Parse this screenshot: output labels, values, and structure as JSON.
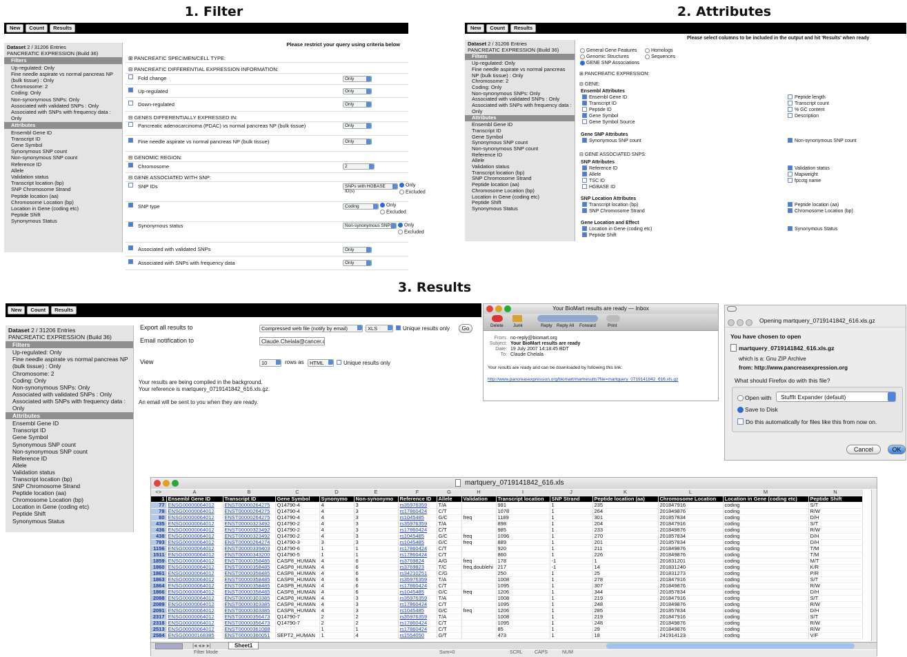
{
  "titles": {
    "filter": "1. Filter",
    "attributes": "2. Attributes",
    "results": "3. Results"
  },
  "toolbar": {
    "new": "New",
    "count": "Count",
    "results": "Results"
  },
  "dataset": {
    "label": "Dataset",
    "value": "2 / 31206 Entries",
    "name": "PANCREATIC EXPRESSION (Build 36)"
  },
  "sidebar": {
    "filters_hd": "Filters",
    "filters": [
      "Up-regulated: Only",
      "Fine needle aspirate vs normal pancreas NP (bulk tissue) : Only",
      "Chromosome: 2",
      "Coding: Only",
      "Non-synonymous SNPs: Only",
      "Associated with validated SNPs : Only",
      "Associated with SNPs with frequency data : Only"
    ],
    "attrs_hd": "Attributes",
    "attrs": [
      "Ensembl Gene ID",
      "Transcript ID",
      "Gene Symbol",
      "Synonymous SNP count",
      "Non-synonymous SNP count",
      "Reference ID",
      "Allele",
      "Validation status",
      "Transcript location (bp)",
      "SNP Chromosome Strand",
      "Peptide location (aa)",
      "Chromosome Location (bp)",
      "Location in Gene (coding etc)",
      "Peptide Shift",
      "Synonymous Status"
    ]
  },
  "filter": {
    "header": "Please restrict your query using criteria below",
    "sec_specimen": "⊞ PANCREATIC SPECIMEN/CELL TYPE:",
    "sec_diff": "⊟ PANCREATIC DIFFERENTIAL EXPRESSION INFORMATION:",
    "fold": "Fold change",
    "up": "Up-regulated",
    "down": "Down-regulated",
    "sec_genes": "⊟ GENES DIFFERENTIALLY EXPRESSED IN:",
    "pdac": "Pancreatic adenocarcinoma (PDAC) vs normal pancreas NP (bulk tissue)",
    "fna": "Fine needle aspirate vs normal pancreas NP (bulk tissue)",
    "sec_region": "⊟ GENOMIC REGION:",
    "chromosome": "Chromosome",
    "chrom_val": "2",
    "sec_snp": "⊟ GENE ASSOCIATED WITH SNP:",
    "snpids": "SNP IDs",
    "snptype": "SNP type",
    "synstatus": "Synonymous status",
    "validated": "Associated with validated SNPs",
    "freq": "Associated with SNPs with frequency data",
    "only": "Only",
    "excluded": "Excluded",
    "sel_only": "Only",
    "sel_hgbase": "SNPs with HGBASE ID(s)",
    "sel_coding": "Coding",
    "sel_nonsyn": "Non-synonymous SNPs"
  },
  "attributes": {
    "header": "Please select columns to be included in the output and hit 'Results' when ready",
    "opt1": "General Gene Features",
    "opt2": "Homologs",
    "opt3": "Genomic Structures",
    "opt4": "Sequences",
    "opt5": "GENE SNP Associations",
    "sec_pe": "⊞ PANCREATIC EXPRESSION:",
    "sec_gene": "⊟ GENE:",
    "ens_hd": "Ensembl Attributes",
    "ens_left": [
      "Ensembl Gene ID",
      "Transcript ID",
      "Peptide ID",
      "Gene Symbol",
      "Gene Symbol Source"
    ],
    "ens_right": [
      "Peptide length",
      "Transcript count",
      "% GC content",
      "Description"
    ],
    "gsnp_hd": "Gene SNP Attributes",
    "gsnp_l": "Synonymous SNP count",
    "gsnp_r": "Non-synonymous SNP count",
    "sec_assoc": "⊟ GENE ASSOCIATED SNPS:",
    "snp_hd": "SNP Attributes",
    "snp_left": [
      "Reference ID",
      "Allele",
      "TSC ID",
      "HGBASE ID"
    ],
    "snp_right": [
      "Validation status",
      "Mapweight",
      "fpcctg name"
    ],
    "loc_hd": "SNP Location Attributes",
    "loc_l": [
      "Transcript location (bp)",
      "SNP Chromosome Strand"
    ],
    "loc_r": [
      "Peptide location (aa)",
      "Chromosome Location (bp)"
    ],
    "gle_hd": "Gene Location and Effect",
    "gle_l": [
      "Location in Gene (coding etc)",
      "Peptide Shift"
    ],
    "gle_r": [
      "Synonymous Status"
    ]
  },
  "results": {
    "export_label": "Export  all results to",
    "export_sel": "Compressed web file (notify by email)",
    "fmt": "XLS",
    "unique": "Unique results only",
    "go": "Go",
    "email_label": "Email notification to",
    "email": "Claude.Chelala@cancer.c",
    "view_label": "View",
    "view_n": "10",
    "rows_as": "rows as",
    "view_fmt": "HTML",
    "view_unique": "Unique results only",
    "msg1": "Your results are being compiled in the background.",
    "msg2": "Your reference is martquery_0719141842_616.xls.gz.",
    "msg3": "An email will be sent to you when they are ready."
  },
  "mail": {
    "title": "Your BioMart results are ready — Inbox",
    "tools": [
      "Delete",
      "Junk",
      "Reply",
      "Reply All",
      "Forward",
      "Print"
    ],
    "from_l": "From:",
    "from": "no-reply@biomart.org",
    "subj_l": "Subject:",
    "subj": "Your BioMart results are ready",
    "date_l": "Date:",
    "date": "19 July 2007 14:18:45 BDT",
    "to_l": "To:",
    "to": "Claude Chelala",
    "body": "Your results are ready and can be downloaded by following this link:",
    "link": "http://www.pancreasexpression.org/biomart/martresults?file=martquery_0719141842_616.xls.gz"
  },
  "dialog": {
    "title": "Opening martquery_0719141842_616.xls.gz",
    "chosen": "You have chosen to open",
    "file": "martquery_0719141842_616.xls.gz",
    "which": "which is a:  Gnu ZIP Archive",
    "from": "from:  http://www.pancreasexpression.org",
    "q": "What should Firefox do with this file?",
    "openwith": "Open with",
    "app": "StuffIt Expander (default)",
    "save": "Save to Disk",
    "auto": "Do this automatically for files like this from now on.",
    "cancel": "Cancel",
    "ok": "OK"
  },
  "excel": {
    "title": "martquery_0719141842_616.xls",
    "cols": [
      "A",
      "B",
      "C",
      "D",
      "E",
      "F",
      "G",
      "H",
      "I",
      "J",
      "K",
      "L",
      "M",
      "N"
    ],
    "headers": [
      "Ensembl Gene ID",
      "Transcript ID",
      "Gene Symbol",
      "Synonymo",
      "Non-synonymo",
      "Reference ID",
      "Allele",
      "Validation",
      "Transcript location",
      "SNP Strand",
      "Peptide location (aa)",
      "Chromosome Location",
      "Location in Gene (coding etc)",
      "Peptide Shift"
    ],
    "rows": [
      [
        "77",
        "ENSG00000064012",
        "ENST00000264275",
        "Q14790-4",
        "4",
        "3",
        "rs35976359",
        "T/A",
        "",
        "991",
        "1",
        "235",
        "201847916",
        "coding",
        "S/T"
      ],
      [
        "78",
        "ENSG00000064012",
        "ENST00000264275",
        "Q14790-4",
        "4",
        "3",
        "rs17860424",
        "C/T",
        "",
        "1078",
        "1",
        "264",
        "201849876",
        "coding",
        "R/W"
      ],
      [
        "80",
        "ENSG00000064012",
        "ENST00000264275",
        "Q14790-4",
        "4",
        "3",
        "rs1045485",
        "G/C",
        "freq",
        "1189",
        "1",
        "301",
        "201857834",
        "coding",
        "D/H"
      ],
      [
        "435",
        "ENSG00000064012",
        "ENST00000323492",
        "Q14790-2",
        "4",
        "3",
        "rs35976359",
        "T/A",
        "",
        "898",
        "1",
        "204",
        "201847916",
        "coding",
        "S/T"
      ],
      [
        "436",
        "ENSG00000064012",
        "ENST00000323492",
        "Q14790-2",
        "4",
        "3",
        "rs17860424",
        "C/T",
        "",
        "985",
        "1",
        "233",
        "201849876",
        "coding",
        "R/W"
      ],
      [
        "438",
        "ENSG00000064012",
        "ENST00000323492",
        "Q14790-2",
        "4",
        "3",
        "rs1045485",
        "G/C",
        "freq",
        "1096",
        "1",
        "270",
        "201857834",
        "coding",
        "D/H"
      ],
      [
        "793",
        "ENSG00000064012",
        "ENST00000264274",
        "Q14790-3",
        "3",
        "3",
        "rs1045485",
        "G/C",
        "freq",
        "889",
        "1",
        "201",
        "201857834",
        "coding",
        "D/H"
      ],
      [
        "1156",
        "ENSG00000064012",
        "ENST00000339403",
        "Q14790-6",
        "1",
        "1",
        "rs17860424",
        "C/T",
        "",
        "920",
        "1",
        "211",
        "201849876",
        "coding",
        "T/M"
      ],
      [
        "1511",
        "ENSG00000064012",
        "ENST00000343200",
        "Q14790-5",
        "1",
        "1",
        "rs17860424",
        "C/T",
        "",
        "860",
        "1",
        "226",
        "201849876",
        "coding",
        "T/M"
      ],
      [
        "1859",
        "ENSG00000064012",
        "ENST00000358485",
        "CASP8_HUMAN",
        "4",
        "6",
        "rs3769824",
        "A/G",
        "freq",
        "178",
        "-1",
        "1",
        "201831201",
        "coding",
        "M/T"
      ],
      [
        "1860",
        "ENSG00000064012",
        "ENST00000358485",
        "CASP8_HUMAN",
        "4",
        "6",
        "rs3769823",
        "T/C",
        "freq,doublehi",
        "217",
        "-1",
        "14",
        "201831240",
        "coding",
        "K/R"
      ],
      [
        "1861",
        "ENSG00000064012",
        "ENST00000358485",
        "CASP8_HUMAN",
        "4",
        "6",
        "rs34210251",
        "C/G",
        "",
        "250",
        "1",
        "25",
        "201831273",
        "coding",
        "P/R"
      ],
      [
        "1863",
        "ENSG00000064012",
        "ENST00000358485",
        "CASP8_HUMAN",
        "4",
        "6",
        "rs35976359",
        "T/A",
        "",
        "1008",
        "1",
        "278",
        "201847916",
        "coding",
        "S/T"
      ],
      [
        "1864",
        "ENSG00000064012",
        "ENST00000358485",
        "CASP8_HUMAN",
        "4",
        "6",
        "rs17860424",
        "C/T",
        "",
        "1095",
        "1",
        "307",
        "201849876",
        "coding",
        "R/W"
      ],
      [
        "1866",
        "ENSG00000064012",
        "ENST00000358485",
        "CASP8_HUMAN",
        "4",
        "6",
        "rs1045485",
        "G/C",
        "freq",
        "1206",
        "1",
        "344",
        "201857834",
        "coding",
        "D/H"
      ],
      [
        "2088",
        "ENSG00000064012",
        "ENST00000303385",
        "CASP8_HUMAN",
        "4",
        "3",
        "rs35976359",
        "T/A",
        "",
        "1008",
        "1",
        "219",
        "201847916",
        "coding",
        "S/T"
      ],
      [
        "2089",
        "ENSG00000064012",
        "ENST00000303385",
        "CASP8_HUMAN",
        "4",
        "3",
        "rs17860424",
        "C/T",
        "",
        "1095",
        "1",
        "248",
        "201849876",
        "coding",
        "R/W"
      ],
      [
        "2091",
        "ENSG00000064012",
        "ENST00000303385",
        "CASP8_HUMAN",
        "4",
        "3",
        "rs1045485",
        "G/C",
        "freq",
        "1206",
        "1",
        "285",
        "201857834",
        "coding",
        "D/H"
      ],
      [
        "2317",
        "ENSG00000064012",
        "ENST00000356473",
        "Q14790-7",
        "2",
        "2",
        "rs35976359",
        "T/A",
        "",
        "1008",
        "1",
        "219",
        "201847916",
        "coding",
        "S/T"
      ],
      [
        "2318",
        "ENSG00000064012",
        "ENST00000356473",
        "Q14790-7",
        "2",
        "2",
        "rs17860424",
        "C/T",
        "",
        "1095",
        "1",
        "248",
        "201849876",
        "coding",
        "R/W"
      ],
      [
        "2513",
        "ENSG00000064012",
        "ENST00000361088",
        "",
        "1",
        "1",
        "rs17860424",
        "C/T",
        "",
        "85",
        "1",
        "29",
        "201849876",
        "coding",
        "R/W"
      ],
      [
        "2584",
        "ENSG00000168385",
        "ENST00000360051",
        "SEPT2_HUMAN",
        "1",
        "4",
        "rs1554050",
        "G/T",
        "",
        "473",
        "1",
        "18",
        "241914123",
        "coding",
        "V/F"
      ]
    ],
    "sheet_tab": "Sheet1",
    "status": "Filter Mode",
    "sum": "Sum=0",
    "scrl": "SCRL",
    "caps": "CAPS",
    "num": "NUM"
  }
}
